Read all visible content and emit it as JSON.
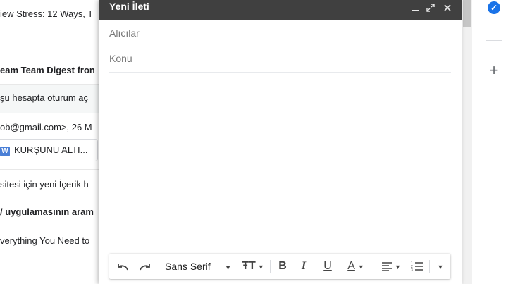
{
  "inbox": {
    "rows": [
      {
        "text": "iew Stress: 12 Ways, T",
        "bold": false
      },
      {
        "text": "eam Team Digest fron",
        "bold": true
      },
      {
        "text": "şu hesapta oturum aç",
        "bold": false
      },
      {
        "text": "ob@gmail.com>, 26 M",
        "bold": false
      },
      {
        "text": "KURŞUNU ALTI...",
        "bold": false,
        "chip_icon": "W"
      },
      {
        "text": "sitesi için yeni İçerik h",
        "bold": false
      },
      {
        "text": "/ uygulamasının aram",
        "bold": true
      },
      {
        "text": "verything You Need to",
        "bold": false
      }
    ]
  },
  "compose": {
    "title": "Yeni İleti",
    "to_placeholder": "Alıcılar",
    "subject_placeholder": "Konu",
    "header_icons": [
      "minimize-icon",
      "expand-icon",
      "close-icon"
    ],
    "toolbar": {
      "font_label": "Sans Serif",
      "icons": [
        "undo-icon",
        "redo-icon",
        "font-select",
        "text-size-icon",
        "bold-icon",
        "italic-icon",
        "underline-icon",
        "text-color-icon",
        "align-icon",
        "numbered-list-icon",
        "more-options-icon"
      ],
      "bold_glyph": "B",
      "italic_glyph": "I",
      "underline_glyph": "U",
      "color_glyph": "A"
    }
  },
  "colors": {
    "header_bg": "#404040",
    "accent_blue": "#1a73e8"
  }
}
